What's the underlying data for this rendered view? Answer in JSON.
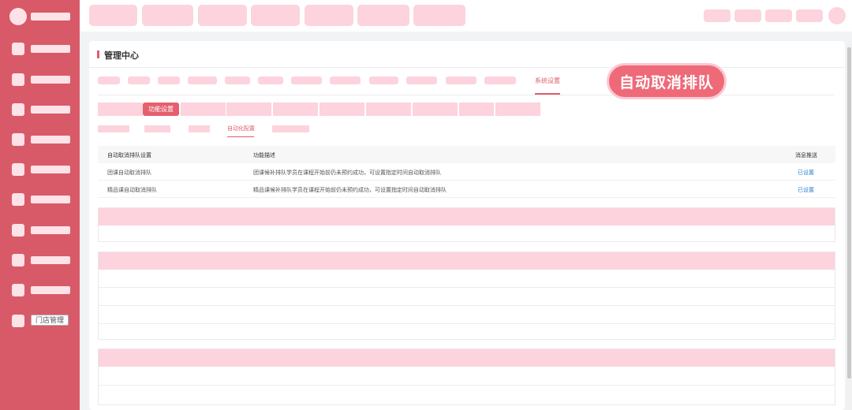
{
  "sidebar": {
    "items": [
      {
        "label": ""
      },
      {
        "label": ""
      },
      {
        "label": ""
      },
      {
        "label": ""
      },
      {
        "label": ""
      },
      {
        "label": ""
      },
      {
        "label": ""
      },
      {
        "label": ""
      },
      {
        "label": ""
      },
      {
        "label": ""
      },
      {
        "label": "门店管理"
      }
    ]
  },
  "main": {
    "title": "管理中心",
    "nav_active_tab": "系统设置",
    "highlight_badge": "自动取消排队",
    "sub_active_tab": "功能设置",
    "third_active_tab": "自动化配置",
    "table": {
      "headers": [
        "自动取消排队设置",
        "功能描述",
        "消息推送"
      ],
      "rows": [
        {
          "name": "团课自动取消排队",
          "desc": "团课候补排队学员在课程开始前仍未预约成功，可设置指定时间自动取消排队",
          "action": "已设置"
        },
        {
          "name": "精品课自动取消排队",
          "desc": "精品课候补排队学员在课程开始前仍未预约成功，可设置指定时间自动取消排队",
          "action": "已设置"
        }
      ]
    }
  },
  "colors": {
    "sidebar": "#d85a68",
    "accent": "#e25c6a",
    "placeholder": "#fdd3de",
    "link": "#2f7fd3"
  }
}
